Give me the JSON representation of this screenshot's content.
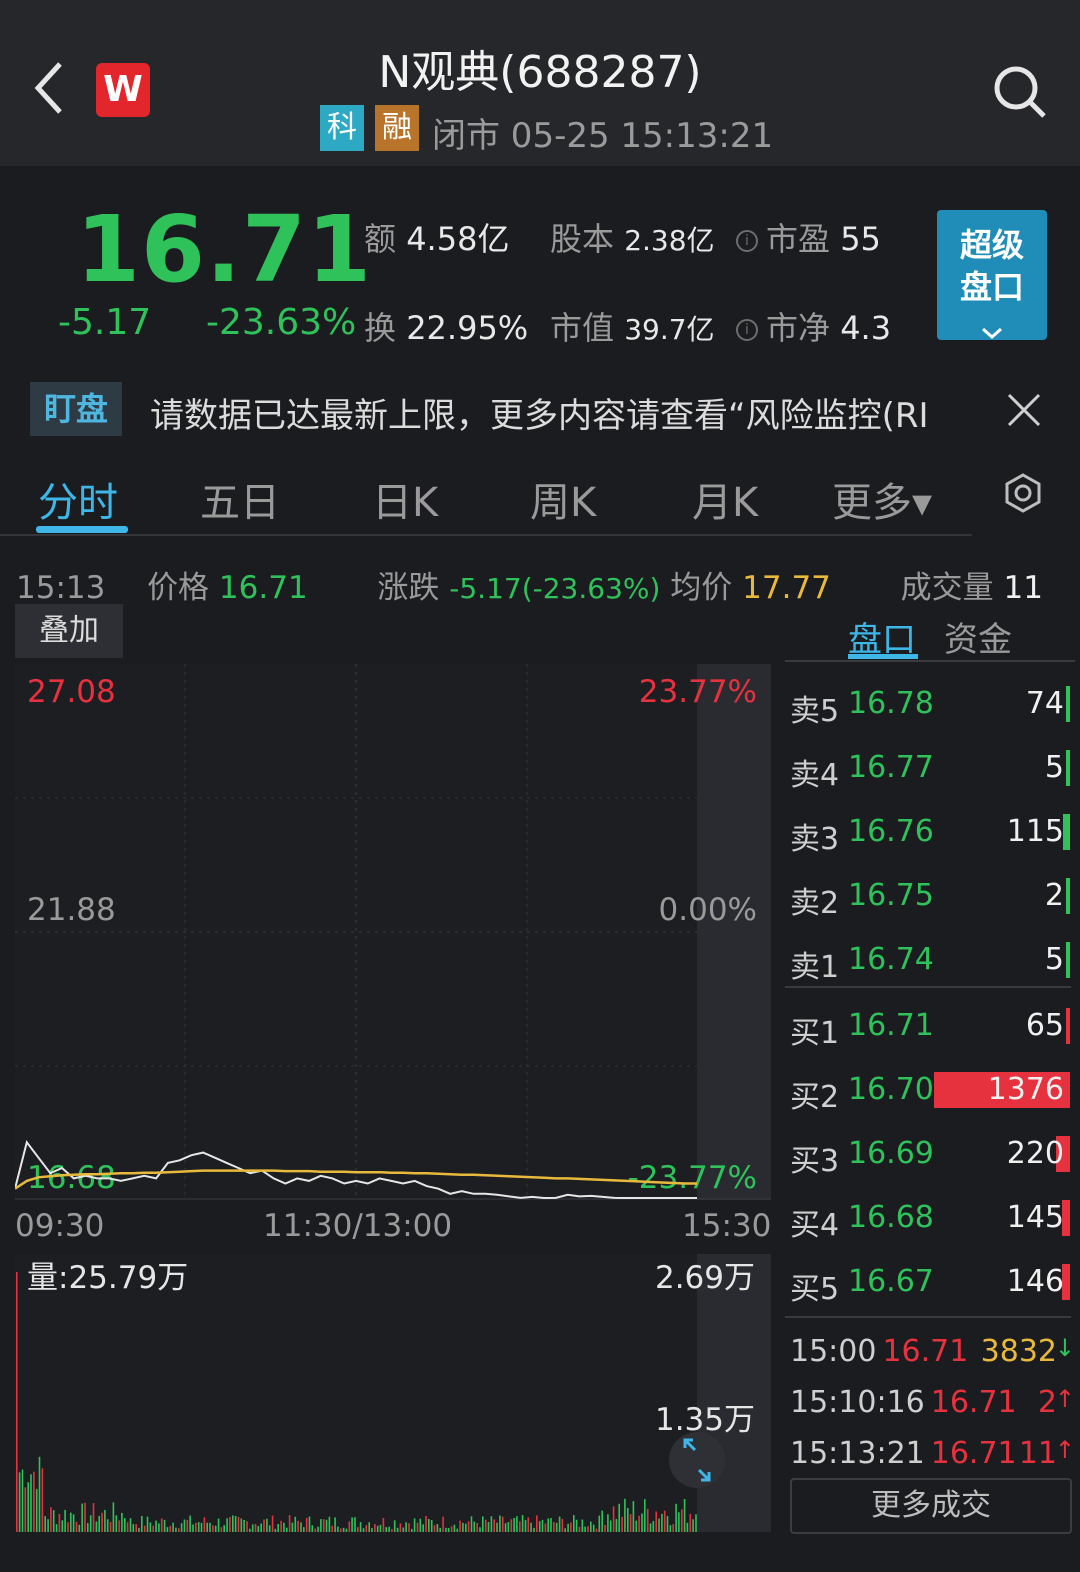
{
  "header": {
    "title": "N观典(688287)",
    "tag_ke": "科",
    "tag_rong": "融",
    "status": "闭市 05-25 15:13:21",
    "brand_logo": "W",
    "icons": [
      "back-arrow-icon",
      "search-icon"
    ]
  },
  "quote": {
    "price": "16.71",
    "change": "-5.17",
    "change_pct": "-23.63%",
    "amount_label": "额",
    "amount_value": "4.58亿",
    "share_capital_label": "股本",
    "share_capital_value": "2.38亿",
    "pe_label": "市盈",
    "pe_value": "55",
    "turnover_label": "换",
    "turnover_value": "22.95%",
    "market_cap_label": "市值",
    "market_cap_value": "39.7亿",
    "pb_label": "市净",
    "pb_value": "4.3",
    "super_button_line1": "超级",
    "super_button_line2": "盘口"
  },
  "ticker": {
    "tag": "盯盘",
    "text": "请数据已达最新上限，更多内容请查看“风险监控(RI"
  },
  "tabs": [
    "分时",
    "五日",
    "日K",
    "周K",
    "月K",
    "更多▾"
  ],
  "info_row": {
    "time": "15:13",
    "price_label": "价格",
    "price_value": "16.71",
    "change_label": "涨跌",
    "change_value": "-5.17(-23.63%)",
    "avg_label": "均价",
    "avg_value": "17.77",
    "volume_label": "成交量",
    "volume_value": "11"
  },
  "overlay_button": "叠加",
  "side_tabs": {
    "pankou": "盘口",
    "zijin": "资金"
  },
  "chart_data": {
    "type": "line",
    "y_top_price": "27.08",
    "y_mid_price": "21.88",
    "y_bottom_price": "16.68",
    "y_top_pct": "23.77%",
    "y_mid_pct": "0.00%",
    "y_bottom_pct": "-23.77%",
    "x_labels": [
      "09:30",
      "11:30/13:00",
      "15:30"
    ],
    "ylim": [
      16.68,
      27.08
    ],
    "series": [
      {
        "name": "",
        "values": [
          16.9,
          17.8,
          17.5,
          17.2,
          17.3,
          17.1,
          17.15,
          17.1,
          17.1,
          17.05,
          17.1,
          17.15,
          17.1,
          17.4,
          17.45,
          17.55,
          17.6,
          17.5,
          17.4,
          17.3,
          17.2,
          17.25,
          17.1,
          17.0,
          17.1,
          17.05,
          17.15,
          17.1,
          17.0,
          17.05,
          17.0,
          17.1,
          17.05,
          17.0,
          17.05,
          16.95,
          16.9,
          16.8,
          16.85,
          16.8,
          16.8,
          16.78,
          16.75,
          16.72,
          16.74,
          16.7,
          16.72,
          16.78,
          16.75,
          16.76,
          16.74,
          16.72,
          16.7,
          16.68,
          16.7,
          16.68,
          16.71,
          16.71,
          16.71
        ],
        "color": "#e6e6e6"
      },
      {
        "name": "",
        "values": [
          16.9,
          17.05,
          17.12,
          17.14,
          17.16,
          17.17,
          17.18,
          17.18,
          17.19,
          17.2,
          17.2,
          17.21,
          17.21,
          17.22,
          17.23,
          17.24,
          17.25,
          17.25,
          17.25,
          17.25,
          17.25,
          17.25,
          17.25,
          17.24,
          17.24,
          17.24,
          17.23,
          17.23,
          17.23,
          17.22,
          17.22,
          17.22,
          17.21,
          17.21,
          17.2,
          17.2,
          17.19,
          17.18,
          17.17,
          17.17,
          17.16,
          17.15,
          17.14,
          17.13,
          17.12,
          17.11,
          17.1,
          17.1,
          17.09,
          17.08,
          17.07,
          17.06,
          17.05,
          17.04,
          17.03,
          17.02,
          17.01,
          17.0,
          17.0
        ],
        "color": "#e8b93c"
      }
    ],
    "volume": {
      "label": "量:25.79万",
      "top_label": "2.69万",
      "mid_label": "1.35万"
    }
  },
  "order_book": {
    "asks": [
      {
        "label": "卖5",
        "price": "16.78",
        "vol": "74",
        "level": 0.03
      },
      {
        "label": "卖4",
        "price": "16.77",
        "vol": "5",
        "level": 0.01
      },
      {
        "label": "卖3",
        "price": "16.76",
        "vol": "115",
        "level": 0.05
      },
      {
        "label": "卖2",
        "price": "16.75",
        "vol": "2",
        "level": 0.01
      },
      {
        "label": "卖1",
        "price": "16.74",
        "vol": "5",
        "level": 0.01
      }
    ],
    "bids": [
      {
        "label": "买1",
        "price": "16.71",
        "vol": "65",
        "level": 0.03
      },
      {
        "label": "买2",
        "price": "16.70",
        "vol": "1376",
        "level": 1.0
      },
      {
        "label": "买3",
        "price": "16.69",
        "vol": "220",
        "level": 0.1
      },
      {
        "label": "买4",
        "price": "16.68",
        "vol": "145",
        "level": 0.06
      },
      {
        "label": "买5",
        "price": "16.67",
        "vol": "146",
        "level": 0.06
      }
    ]
  },
  "trades": [
    {
      "time": "15:00",
      "price": "16.71",
      "vol": "3832",
      "dir": "↓"
    },
    {
      "time": "15:10:16",
      "price": "16.71",
      "vol": "2",
      "dir": "↑"
    },
    {
      "time": "15:13:21",
      "price": "16.71",
      "vol": "11",
      "dir": "↑"
    }
  ],
  "more_trades": "更多成交"
}
